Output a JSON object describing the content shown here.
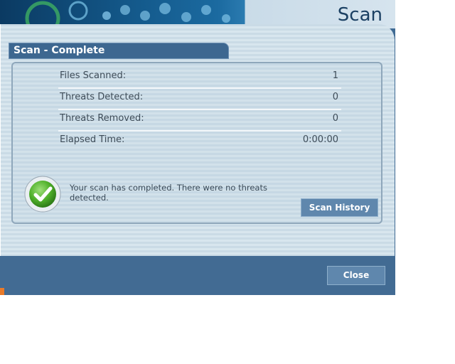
{
  "window": {
    "title": "Scan"
  },
  "section": {
    "header": "Scan - Complete"
  },
  "results": {
    "rows": [
      {
        "label": "Files Scanned:",
        "value": "1"
      },
      {
        "label": "Threats Detected:",
        "value": "0"
      },
      {
        "label": "Threats Removed:",
        "value": "0"
      },
      {
        "label": "Elapsed Time:",
        "value": "0:00:00"
      }
    ],
    "message": "Your scan has completed. There were no threats detected."
  },
  "buttons": {
    "scan_history": "Scan History",
    "close": "Close"
  },
  "colors": {
    "accent": "#3d6790",
    "button": "#5f87ad",
    "success": "#5cb82e"
  },
  "icons": {
    "status": "checkmark-icon"
  }
}
